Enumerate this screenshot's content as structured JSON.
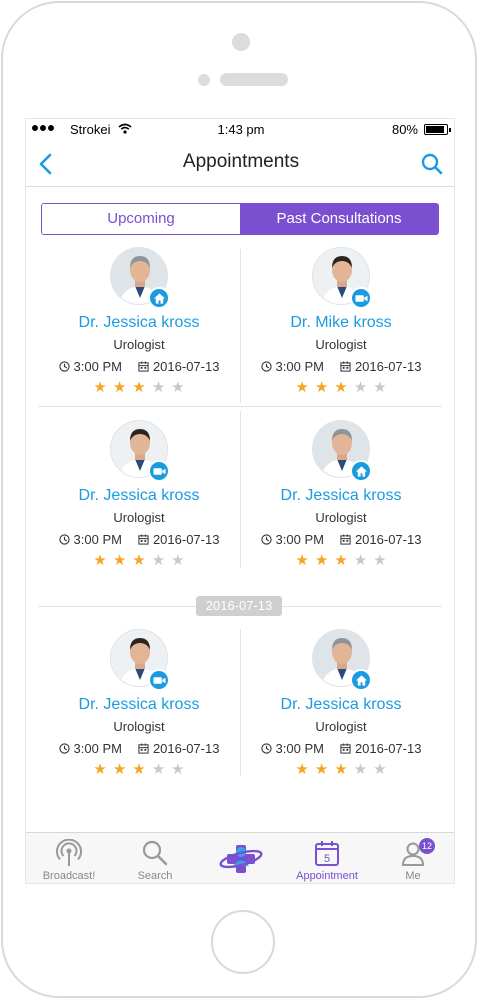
{
  "status_bar": {
    "carrier": "Strokei",
    "time": "1:43 pm",
    "battery": "80%"
  },
  "nav": {
    "title": "Appointments",
    "back_icon": "chevron-left-icon",
    "search_icon": "search-icon"
  },
  "segments": [
    {
      "label": "Upcoming",
      "active": false
    },
    {
      "label": "Past Consultations",
      "active": true
    }
  ],
  "date_separator": "2016-07-13",
  "cards": [
    {
      "name": "Dr. Jessica kross",
      "specialty": "Urologist",
      "time": "3:00 PM",
      "date": "2016-07-13",
      "rating": 3,
      "max_rating": 5,
      "badge": "home-icon",
      "avatar": "older"
    },
    {
      "name": "Dr. Mike kross",
      "specialty": "Urologist",
      "time": "3:00 PM",
      "date": "2016-07-13",
      "rating": 3,
      "max_rating": 5,
      "badge": "video-icon",
      "avatar": "young"
    },
    {
      "name": "Dr. Jessica kross",
      "specialty": "Urologist",
      "time": "3:00 PM",
      "date": "2016-07-13",
      "rating": 3,
      "max_rating": 5,
      "badge": "video-icon",
      "avatar": "young"
    },
    {
      "name": "Dr. Jessica kross",
      "specialty": "Urologist",
      "time": "3:00 PM",
      "date": "2016-07-13",
      "rating": 3,
      "max_rating": 5,
      "badge": "home-icon",
      "avatar": "older"
    },
    {
      "name": "Dr. Jessica kross",
      "specialty": "Urologist",
      "time": "3:00 PM",
      "date": "2016-07-13",
      "rating": 3,
      "max_rating": 5,
      "badge": "video-icon",
      "avatar": "young"
    },
    {
      "name": "Dr. Jessica kross",
      "specialty": "Urologist",
      "time": "3:00 PM",
      "date": "2016-07-13",
      "rating": 3,
      "max_rating": 5,
      "badge": "home-icon",
      "avatar": "older"
    }
  ],
  "tabs": [
    {
      "label": "Broadcast!",
      "icon": "broadcast-icon",
      "active": false
    },
    {
      "label": "Search",
      "icon": "search-icon",
      "active": false
    },
    {
      "label": "",
      "icon": "app-logo-icon",
      "active": false
    },
    {
      "label": "Appointment",
      "icon": "calendar-icon",
      "active": true
    },
    {
      "label": "Me",
      "icon": "user-icon",
      "active": false,
      "badge": "12"
    }
  ],
  "colors": {
    "accent_purple": "#7a4fd0",
    "accent_blue": "#1a9be0",
    "star_on": "#f5a623",
    "star_off": "#c8c8c8"
  }
}
